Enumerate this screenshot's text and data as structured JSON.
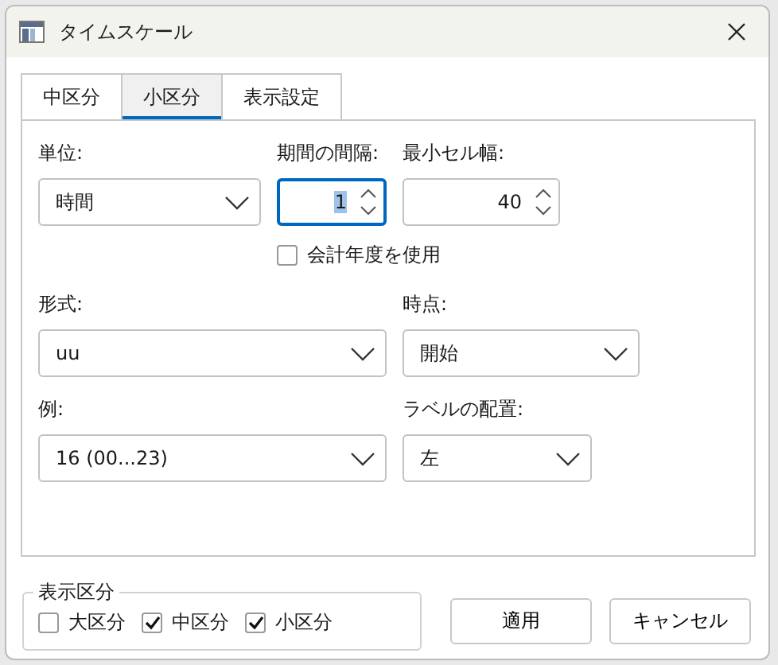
{
  "window": {
    "title": "タイムスケール"
  },
  "tabs": [
    {
      "label": "中区分",
      "selected": false
    },
    {
      "label": "小区分",
      "selected": true
    },
    {
      "label": "表示設定",
      "selected": false
    }
  ],
  "rows": [
    [
      {
        "kind": "combo",
        "label": "単位:",
        "value": "時間"
      },
      {
        "kind": "spin",
        "label": "期間の間隔:",
        "value": "1",
        "focused": true
      },
      {
        "kind": "spin",
        "label": "最小セル幅:",
        "value": "40",
        "focused": false
      }
    ],
    [
      {
        "kind": "checkbox",
        "label": "会計年度を使用",
        "checked": false
      }
    ],
    [
      {
        "kind": "combo",
        "label": "形式:",
        "value": "uu"
      },
      {
        "kind": "combo",
        "label": "時点:",
        "value": "開始"
      }
    ],
    [
      {
        "kind": "combo",
        "label": "例:",
        "value": "16 (00...23)"
      },
      {
        "kind": "combo",
        "label": "ラベルの配置:",
        "value": "左"
      }
    ]
  ],
  "display_group": {
    "title": "表示区分",
    "items": [
      {
        "label": "大区分",
        "checked": false
      },
      {
        "label": "中区分",
        "checked": true
      },
      {
        "label": "小区分",
        "checked": true
      }
    ]
  },
  "buttons": [
    "適用",
    "キャンセル"
  ]
}
